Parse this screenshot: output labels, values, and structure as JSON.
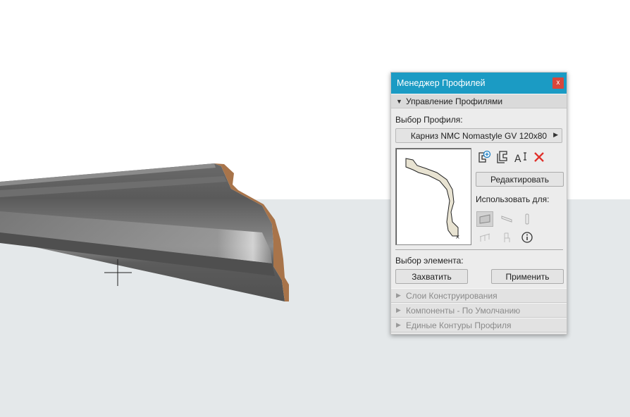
{
  "palette": {
    "title": "Менеджер Профилей",
    "close_label": "x",
    "sections": {
      "manage": "Управление Профилями",
      "layers": "Слои Конструирования",
      "components": "Компоненты - По Умолчанию",
      "contours": "Единые Контуры Профиля"
    },
    "profile_select_label": "Выбор Профиля:",
    "profile_select_value": "Карниз NMC Nomastyle GV 120x80",
    "edit_button": "Редактировать",
    "use_for_label": "Использовать для:",
    "element_select_label": "Выбор элемента:",
    "capture_button": "Захватить",
    "apply_button": "Применить",
    "use_for_items": [
      "wall-icon",
      "beam-icon",
      "column-icon",
      "railing-icon",
      "object-icon",
      "info-icon"
    ]
  },
  "colors": {
    "title_bar": "#1b9bc4",
    "close": "#d9463b",
    "profile_section": "#a8744a",
    "profile_body": "#5f5f5f",
    "floor": "#e4e8ea"
  }
}
